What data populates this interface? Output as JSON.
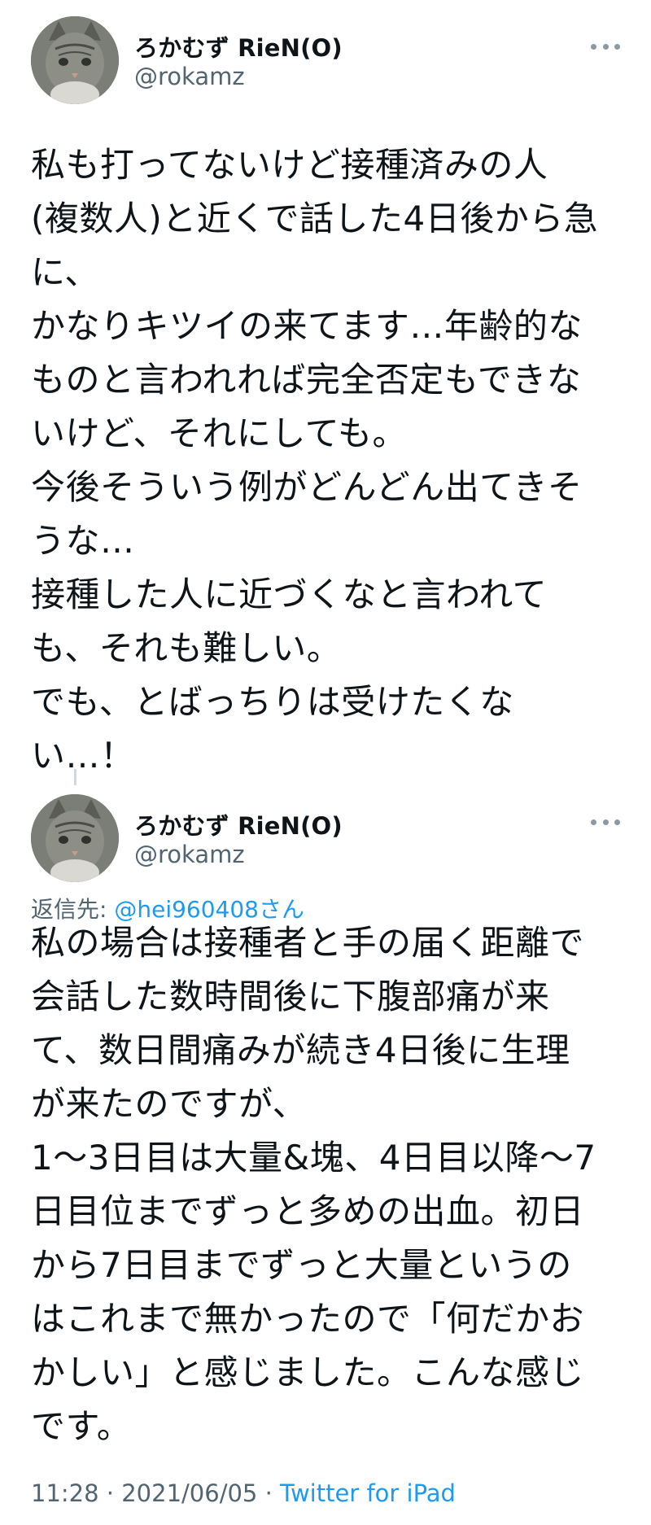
{
  "tweets": [
    {
      "author_name": "ろかむず RieN(O)",
      "author_handle": "@rokamz",
      "text": "私も打ってないけど接種済みの人\n(複数人)と近くで話した4日後から急\nに、\nかなりキツイの来てます…年齢的な\nものと言われれば完全否定もできな\nいけど、それにしても。\n今後そういう例がどんどん出てきそ\nうな…\n接種した人に近づくなと言われて\nも、それも難しい。\nでも、とばっちりは受けたくな\nい…！"
    },
    {
      "author_name": "ろかむず RieN(O)",
      "author_handle": "@rokamz",
      "reply_label": "返信先: ",
      "reply_mention": "@hei960408さん",
      "text": "私の場合は接種者と手の届く距離で\n会話した数時間後に下腹部痛が来\nて、数日間痛みが続き4日後に生理\nが来たのですが、\n1〜3日目は大量&塊、4日目以降〜7\n日目位までずっと多めの出血。初日\nから7日目までずっと大量というの\nはこれまで無かったので「何だかお\nかしい」と感じました。こんな感じ\nです。",
      "meta_time": "11:28 · 2021/06/05 · ",
      "meta_source": "Twitter for iPad"
    }
  ],
  "colors": {
    "text": "#0f1419",
    "secondary": "#536471",
    "link": "#1d9bf0"
  },
  "icons": {
    "more": "more-horizontal-icon",
    "avatar": "cat-avatar"
  }
}
